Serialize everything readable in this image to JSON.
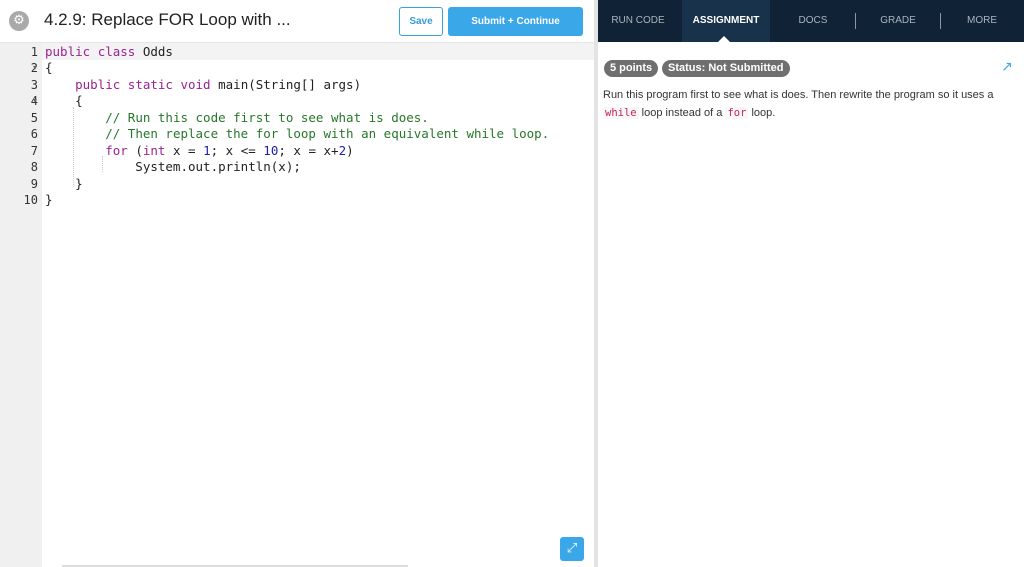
{
  "header": {
    "title": "4.2.9: Replace FOR Loop with ...",
    "save_label": "Save",
    "submit_label": "Submit + Continue"
  },
  "editor": {
    "line_numbers": [
      "1",
      "2",
      "3",
      "4",
      "5",
      "6",
      "7",
      "8",
      "9",
      "10"
    ],
    "lines": [
      "public class Odds",
      "{",
      "    public static void main(String[] args)",
      "    {",
      "        // Run this code first to see what is does.",
      "        // Then replace the for loop with an equivalent while loop.",
      "        for (int x = 1; x <= 10; x = x+2)",
      "            System.out.println(x);",
      "    }",
      "}"
    ]
  },
  "tabs": {
    "run_code": "RUN CODE",
    "assignment": "ASSIGNMENT",
    "docs": "DOCS",
    "grade": "GRADE",
    "more": "MORE"
  },
  "assignment": {
    "points": "5 points",
    "status": "Status: Not Submitted",
    "desc_before": "Run this program first to see what is does. Then rewrite the program so it uses a ",
    "code_while": "while",
    "desc_mid": " loop instead of a ",
    "code_for": "for",
    "desc_after": " loop."
  },
  "colors": {
    "accent": "#3aa8e8",
    "tabbar": "#0f2236",
    "keyword": "#9b2393",
    "comment": "#27772a"
  },
  "icons": {
    "settings": "gear-icon",
    "expand": "expand-icon",
    "edit": "external-edit-icon"
  }
}
